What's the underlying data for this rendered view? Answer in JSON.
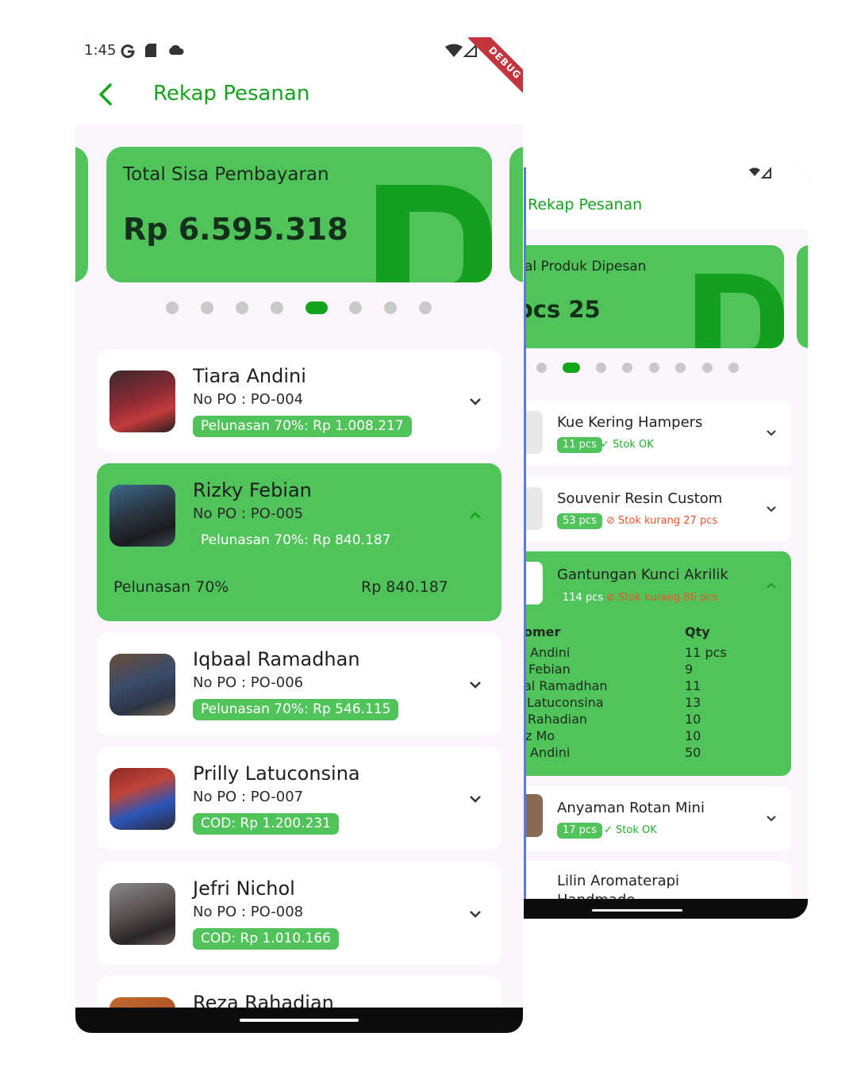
{
  "colors": {
    "primary": "#14a41c",
    "card_green": "#50c35a",
    "background": "#fcf5fe",
    "warning": "#f1542d",
    "debug_ribbon": "#c3343d"
  },
  "front_screen": {
    "status_bar": {
      "time": "1:45",
      "icons": [
        "google-icon",
        "sd-card-icon",
        "cloud-icon",
        "wifi-icon",
        "signal-icon"
      ]
    },
    "debug_banner": "DEBUG",
    "app_bar": {
      "title": "Rekap Pesanan",
      "back_icon": "chevron-left-icon"
    },
    "summary_card": {
      "label": "Total Sisa Pembayaran",
      "value": "Rp 6.595.318"
    },
    "carousel": {
      "page_count": 8,
      "active_index": 4
    },
    "orders": [
      {
        "name": "Tiara Andini",
        "po": "No PO : PO-004",
        "badge": "Pelunasan 70%: Rp 1.008.217",
        "expanded": false
      },
      {
        "name": "Rizky Febian",
        "po": "No PO : PO-005",
        "badge": "Pelunasan 70%: Rp 840.187",
        "expanded": true,
        "detail": {
          "label": "Pelunasan 70%",
          "value": "Rp 840.187"
        }
      },
      {
        "name": "Iqbaal Ramadhan",
        "po": "No PO : PO-006",
        "badge": "Pelunasan 70%: Rp 546.115",
        "expanded": false
      },
      {
        "name": "Prilly Latuconsina",
        "po": "No PO : PO-007",
        "badge": "COD: Rp 1.200.231",
        "expanded": false
      },
      {
        "name": "Jefri Nichol",
        "po": "No PO : PO-008",
        "badge": "COD: Rp 1.010.166",
        "expanded": false
      },
      {
        "name": "Reza Rahadian"
      }
    ]
  },
  "back_screen": {
    "app_bar": {
      "title": "Rekap Pesanan"
    },
    "summary_card": {
      "label": "al Produk Dipesan",
      "value": "25 pcs"
    },
    "carousel": {
      "page_count": 8,
      "active_index": 1
    },
    "products": [
      {
        "name": "Kue Kering Hampers",
        "qty": "11 pcs",
        "stock": "✓ Stok OK",
        "stock_ok": true
      },
      {
        "name": "Souvenir Resin Custom",
        "qty": "53 pcs",
        "stock": "⊘ Stok kurang 27 pcs",
        "stock_ok": false
      },
      {
        "name": "Gantungan Kunci Akrilik",
        "qty": "114 pcs",
        "stock": "⊘ Stok kurang 86 pcs",
        "stock_ok": false,
        "expanded": true,
        "table": {
          "headers": [
            "omer",
            "Qty"
          ],
          "rows": [
            [
              "Andini",
              "11 pcs"
            ],
            [
              "Febian",
              "9"
            ],
            [
              "al Ramadhan",
              "11"
            ],
            [
              "Latuconsina",
              "13"
            ],
            [
              "Rahadian",
              "10"
            ],
            [
              "z Mo",
              "10"
            ],
            [
              "Andini",
              "50"
            ]
          ]
        }
      },
      {
        "name": "Anyaman Rotan Mini",
        "qty": "17 pcs",
        "stock": "✓ Stok OK",
        "stock_ok": true
      },
      {
        "name": "Lilin Aromaterapi",
        "name_line2": "Handmade"
      }
    ]
  }
}
